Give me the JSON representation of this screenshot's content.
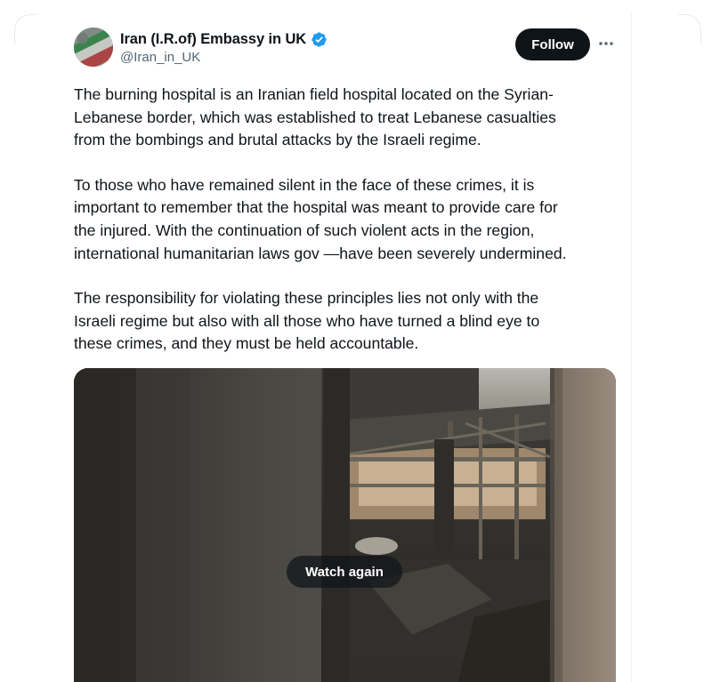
{
  "author": {
    "display_name": "Iran (I.R.of) Embassy in UK",
    "handle": "@Iran_in_UK",
    "verified": true
  },
  "actions": {
    "follow_label": "Follow",
    "more_icon": "more-horizontal-icon"
  },
  "tweet": {
    "paragraphs": [
      {
        "lines": [
          "The burning hospital is an Iranian field hospital located on the Syrian-",
          "Lebanese border, which was established to treat Lebanese casualties",
          "from the bombings and brutal attacks by the Israeli regime."
        ]
      },
      {
        "lines": [
          "To those who have remained silent in the face of these crimes, it is",
          "important to remember that the hospital was meant to provide care for",
          "the injured. With the continuation of such violent acts in the region,",
          "international humanitarian laws gov —have been severely undermined."
        ]
      },
      {
        "lines": [
          "The responsibility for violating these principles lies not only with the",
          "Israeli regime but also with all those who have turned a blind eye to",
          "these crimes, and they must be held accountable."
        ]
      }
    ]
  },
  "media": {
    "watch_again_label": "Watch again"
  },
  "colors": {
    "verified_blue": "#1d9bf0",
    "follow_bg": "#0f1419",
    "secondary_text": "#536471"
  }
}
